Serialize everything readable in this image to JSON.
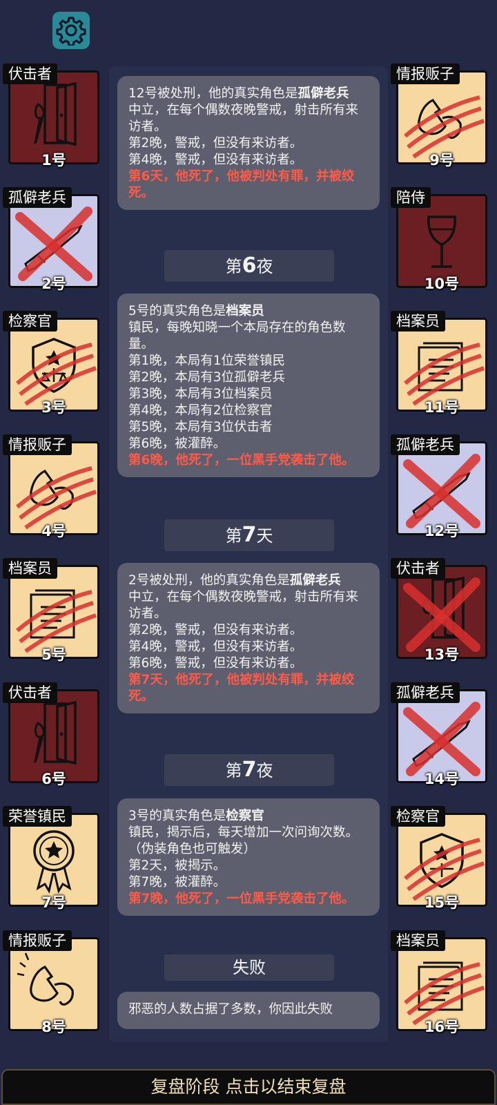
{
  "settings": {
    "icon": "gear-icon"
  },
  "left_players": [
    {
      "role": "伏击者",
      "number": "1号",
      "bg": "dark",
      "icon": "door-knife-icon",
      "state": "alive"
    },
    {
      "role": "孤僻老兵",
      "number": "2号",
      "bg": "lav",
      "icon": "rifle-icon",
      "state": "executed"
    },
    {
      "role": "检察官",
      "number": "3号",
      "bg": "tan",
      "icon": "badge-icon",
      "state": "attacked"
    },
    {
      "role": "情报贩子",
      "number": "4号",
      "bg": "tan",
      "icon": "whisper-icon",
      "state": "attacked"
    },
    {
      "role": "档案员",
      "number": "5号",
      "bg": "tan",
      "icon": "documents-icon",
      "state": "attacked"
    },
    {
      "role": "伏击者",
      "number": "6号",
      "bg": "dark",
      "icon": "door-knife-icon",
      "state": "alive"
    },
    {
      "role": "荣誉镇民",
      "number": "7号",
      "bg": "tan",
      "icon": "medal-icon",
      "state": "alive"
    },
    {
      "role": "情报贩子",
      "number": "8号",
      "bg": "tan",
      "icon": "whisper-icon",
      "state": "alive"
    }
  ],
  "right_players": [
    {
      "role": "情报贩子",
      "number": "9号",
      "bg": "tan",
      "icon": "whisper-icon",
      "state": "attacked"
    },
    {
      "role": "陪侍",
      "number": "10号",
      "bg": "dark",
      "icon": "wine-glass-icon",
      "state": "alive"
    },
    {
      "role": "档案员",
      "number": "11号",
      "bg": "tan",
      "icon": "documents-icon",
      "state": "attacked"
    },
    {
      "role": "孤僻老兵",
      "number": "12号",
      "bg": "lav",
      "icon": "rifle-icon",
      "state": "executed"
    },
    {
      "role": "伏击者",
      "number": "13号",
      "bg": "dark",
      "icon": "door-knife-icon",
      "state": "executed"
    },
    {
      "role": "孤僻老兵",
      "number": "14号",
      "bg": "lav",
      "icon": "rifle-icon",
      "state": "executed"
    },
    {
      "role": "检察官",
      "number": "15号",
      "bg": "tan",
      "icon": "badge-icon",
      "state": "attacked"
    },
    {
      "role": "档案员",
      "number": "16号",
      "bg": "tan",
      "icon": "documents-icon",
      "state": "attacked"
    }
  ],
  "log": {
    "msg1": {
      "l1a": "12号被处刑，他的真实角色是",
      "l1b": "孤僻老兵",
      "l2": "中立，在每个偶数夜晚警戒，射击所有来访者。",
      "l3": "第2晚，警戒，但没有来访者。",
      "l4": "第4晚，警戒，但没有来访者。",
      "death": "第6天，他死了，他被判处有罪，并被绞死。"
    },
    "hdr1": {
      "pre": "第",
      "num": "6",
      "post": "夜"
    },
    "msg2": {
      "l1a": "5号的真实角色是",
      "l1b": "档案员",
      "l2": "镇民，每晚知晓一个本局存在的角色数量。",
      "l3": "第1晚，本局有1位荣誉镇民",
      "l4": "第2晚，本局有3位孤僻老兵",
      "l5": "第3晚，本局有3位档案员",
      "l6": "第4晚，本局有2位检察官",
      "l7": "第5晚，本局有3位伏击者",
      "l8": "第6晚，被灌醉。",
      "death": "第6晚，他死了，一位黑手党袭击了他。"
    },
    "hdr2": {
      "pre": "第",
      "num": "7",
      "post": "天"
    },
    "msg3": {
      "l1a": "2号被处刑，他的真实角色是",
      "l1b": "孤僻老兵",
      "l2": "中立，在每个偶数夜晚警戒，射击所有来访者。",
      "l3": "第2晚，警戒，但没有来访者。",
      "l4": "第4晚，警戒，但没有来访者。",
      "l5": "第6晚，警戒，但没有来访者。",
      "death": "第7天，他死了，他被判处有罪，并被绞死。"
    },
    "hdr3": {
      "pre": "第",
      "num": "7",
      "post": "夜"
    },
    "msg4": {
      "l1a": "3号的真实角色是",
      "l1b": "检察官",
      "l2": "镇民，揭示后，每天增加一次问询次数。（伪装角色也可触发）",
      "l3": "第2天，被揭示。",
      "l4": "第7晚，被灌醉。",
      "death": "第7晚，他死了，一位黑手党袭击了他。"
    },
    "hdr4": {
      "label": "失败"
    },
    "msg5": {
      "text": "邪恶的人数占据了多数，你因此失败"
    }
  },
  "footer": {
    "label": "复盘阶段 点击以结束复盘"
  },
  "colors": {
    "background": "#232944",
    "death_text": "#ff5a48",
    "card_dark": "#6b1f22",
    "card_tan": "#f6d8a0",
    "card_lavender": "#c9c9ea"
  }
}
